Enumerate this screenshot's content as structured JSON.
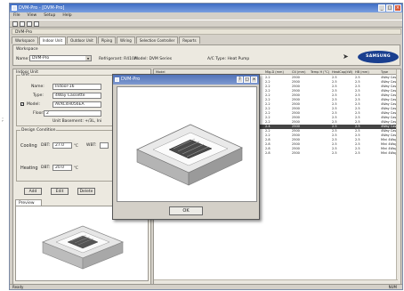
{
  "window": {
    "title": "DVM-Pro - [DVM-Pro]",
    "min": "_",
    "max": "□",
    "close": "×"
  },
  "menu": [
    "File",
    "View",
    "Setup",
    "Help"
  ],
  "doc_tab": "DVM-Pro",
  "tabs": [
    "Workspace",
    "Indoor Unit",
    "Outdoor Unit",
    "Piping",
    "Wiring",
    "Selection Controller",
    "Reports"
  ],
  "workspace": {
    "title": "Workspace",
    "name_label": "Name:",
    "name_value": "DVM-Pro",
    "refrigerant": "Refrigerant: R410A",
    "model": "Model: DVM Series",
    "ac_type": "A/C Type: Heat Pump",
    "brand": "SAMSUNG"
  },
  "indoor": {
    "title": "Indoor Unit",
    "unit_group": "Unit",
    "name_label": "Name:",
    "name_value": "Indoor-16",
    "type_label": "Type:",
    "type_value": "4Way Cassette",
    "model_label": "Model:",
    "model_value": "AVXC4H056EA",
    "model_checked": "✓",
    "floor_label": "Floor:",
    "floor_value": "2",
    "unit_note": "Unit Basement: +/3L, Ini",
    "cond_group": "Design Condition",
    "cooling_label": "Cooling",
    "db_label": "DBT:",
    "cooling_db": "27.0",
    "wb_label": "WBT:",
    "heating_label": "Heating",
    "heating_db": "20.0",
    "unit_deg": "°C",
    "add": "Add",
    "edit": "Edit",
    "delete": "Delete",
    "preview_tab": "Preview"
  },
  "grid": {
    "columns": [
      "Model",
      "Mig-D (mm)",
      "Ctl (mm)",
      "Temp H (°C)",
      "HeatCap(kW)",
      "HB (mm)",
      "Type"
    ],
    "rows": [
      [
        "AVXC4H056EA",
        "2.2",
        "2500",
        "2.5",
        "2.5",
        "4Way Cassette"
      ],
      [
        "AVXC4H056EA",
        "2.2",
        "2500",
        "2.5",
        "2.5",
        "4Way Cassette"
      ],
      [
        "AVXC4H056EA",
        "2.2",
        "2500",
        "2.5",
        "2.5",
        "4Way Cassette"
      ],
      [
        "AVXC4H056EA",
        "2.2",
        "2500",
        "2.5",
        "2.5",
        "4Way Cassette"
      ],
      [
        "AVXC4H056EA",
        "2.2",
        "2500",
        "2.5",
        "2.5",
        "4Way Cassette"
      ],
      [
        "AVXC4H056EA",
        "2.2",
        "2500",
        "2.5",
        "2.5",
        "4Way Cassette"
      ],
      [
        "AVXC4H056EA",
        "2.2",
        "2500",
        "2.5",
        "2.5",
        "4Way Cassette"
      ],
      [
        "AVXC4H056EA",
        "2.2",
        "2500",
        "2.5",
        "2.5",
        "4Way Cassette"
      ],
      [
        "AVXC4H056EA",
        "2.2",
        "2500",
        "2.5",
        "2.5",
        "4Way Cassette"
      ],
      [
        "AVXC4H056EA",
        "2.2",
        "2500",
        "2.5",
        "2.5",
        "4Way Cassette"
      ],
      [
        "AVXC4H056EA",
        "2.2",
        "2500",
        "2.5",
        "2.5",
        "4Way Cassette"
      ],
      [
        "AVXC4H056EA",
        "2.4",
        "2500",
        "2.5",
        "2.5",
        "4Way Cassette"
      ],
      [
        "AVXC4H056EA",
        "2.2",
        "2500",
        "2.5",
        "2.5",
        "4Way Cassette"
      ],
      [
        "AVXC4H056EA",
        "2.2",
        "2500",
        "2.5",
        "2.5",
        "4Way Cassette"
      ],
      [
        "AVXC4H056EA",
        "2.8",
        "2500",
        "2.5",
        "2.5",
        "Mini 4Way Cassette"
      ],
      [
        "AVXC4H056EA",
        "2.8",
        "2500",
        "2.5",
        "2.5",
        "Mini 4Way Cassette"
      ],
      [
        "AVXC4H056EA",
        "2.8",
        "2500",
        "2.5",
        "2.5",
        "Mini 4Way Cassette"
      ],
      [
        "AVXC4H056EA",
        "2.8",
        "2500",
        "2.5",
        "2.5",
        "Mini 4Way Cassette"
      ]
    ],
    "selected_row": 11
  },
  "status": {
    "left": "Ready",
    "right": "NUM"
  },
  "dialog": {
    "title": "DVM-Pro",
    "ok": "OK"
  },
  "side_mark": ";",
  "colors": {
    "title_blue": "#3e6cc4",
    "brand_blue": "#1a3f8f",
    "selection": "#444444"
  }
}
